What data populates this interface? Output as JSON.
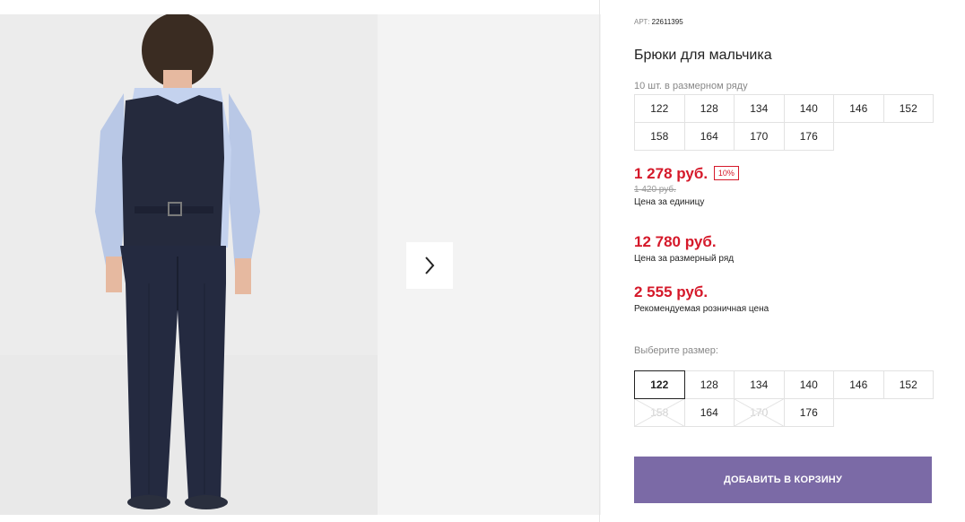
{
  "product": {
    "art_label": "АРТ:",
    "art_number": "22611395",
    "title": "Брюки для мальчика",
    "range_note": "10 шт. в размерном ряду"
  },
  "size_range": {
    "rows": [
      [
        "122",
        "128",
        "134",
        "140",
        "146",
        "152"
      ],
      [
        "158",
        "164",
        "170",
        "176"
      ]
    ]
  },
  "prices": {
    "unit_price": "1 278 руб.",
    "discount_badge": "10%",
    "old_price": "1 420 руб.",
    "unit_note": "Цена за единицу",
    "range_price": "12 780 руб.",
    "range_note": "Цена за размерный ряд",
    "retail_price": "2 555 руб.",
    "retail_note": "Рекомендуемая розничная цена"
  },
  "size_select": {
    "label": "Выберите размер:",
    "selected": "122",
    "rows": [
      [
        "122",
        "128",
        "134",
        "140",
        "146",
        "152"
      ],
      [
        "158",
        "164",
        "170",
        "176"
      ]
    ],
    "unavailable": [
      "158",
      "170"
    ]
  },
  "actions": {
    "add_to_cart": "ДОБАВИТЬ В КОРЗИНУ"
  },
  "colors": {
    "price_red": "#d5192a",
    "button_purple": "#7b6aa6"
  },
  "icons": {
    "next": "chevron-right-icon"
  }
}
